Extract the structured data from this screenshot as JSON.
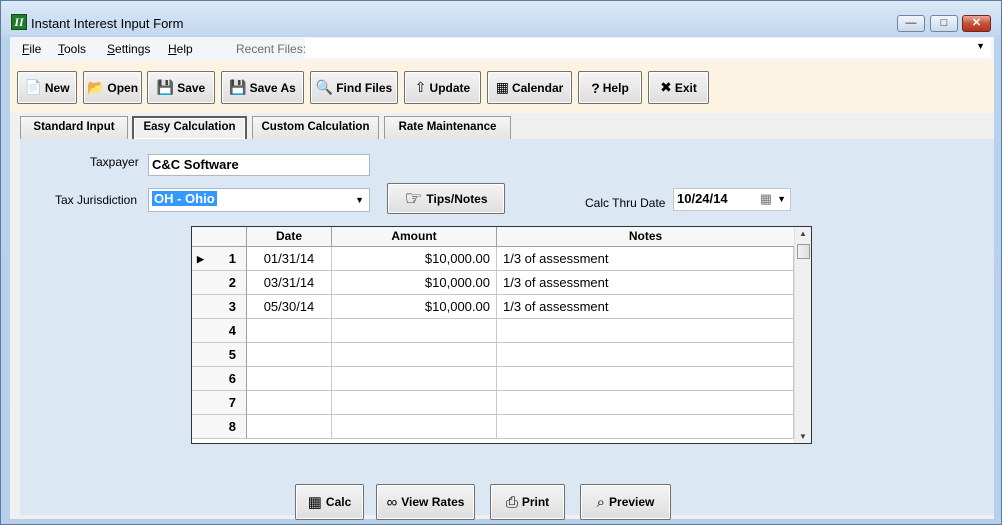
{
  "window": {
    "title": "Instant Interest Input Form",
    "app_icon_glyph": "II",
    "minimize_glyph": "—",
    "maximize_glyph": "□",
    "close_glyph": "✕"
  },
  "menu": {
    "file_key": "F",
    "file_rest": "ile",
    "tools_key": "T",
    "tools_rest": "ools",
    "settings_key": "S",
    "settings_rest": "ettings",
    "help_key": "H",
    "help_rest": "elp",
    "recent_files_label": "Recent Files:",
    "recent_files_value": "",
    "dropdown_arrow": "▼"
  },
  "toolbar": {
    "new": {
      "label": "New",
      "icon": "📄"
    },
    "open": {
      "label": "Open",
      "icon": "📂"
    },
    "save": {
      "label": "Save",
      "icon": "💾"
    },
    "save_as": {
      "label": "Save As",
      "icon": "💾"
    },
    "find_files": {
      "label": "Find Files",
      "icon": "🔍"
    },
    "update": {
      "label": "Update",
      "icon": "⇧"
    },
    "calendar": {
      "label": "Calendar",
      "icon": "▦"
    },
    "help": {
      "label": "Help",
      "icon": "?"
    },
    "exit": {
      "label": "Exit",
      "icon": "✖"
    }
  },
  "tabs": [
    {
      "label": "Standard Input",
      "active": false
    },
    {
      "label": "Easy Calculation",
      "active": true
    },
    {
      "label": "Custom Calculation",
      "active": false
    },
    {
      "label": "Rate Maintenance",
      "active": false
    }
  ],
  "form": {
    "taxpayer_label": "Taxpayer",
    "taxpayer_value": "C&C Software",
    "jurisdiction_label": "Tax Jurisdiction",
    "jurisdiction_value": "OH  - Ohio",
    "tips_label": "Tips/Notes",
    "tips_icon": "☞",
    "calc_thru_label": "Calc Thru Date",
    "calc_thru_value": "10/24/14",
    "calendar_icon": "▦",
    "dropdown_arrow": "▼"
  },
  "grid": {
    "headers": {
      "date": "Date",
      "amount": "Amount",
      "notes": "Notes"
    },
    "current_row_marker": "▶",
    "rows": [
      {
        "num": "1",
        "date": "01/31/14",
        "amount": "$10,000.00",
        "notes": "1/3 of assessment"
      },
      {
        "num": "2",
        "date": "03/31/14",
        "amount": "$10,000.00",
        "notes": "1/3 of assessment"
      },
      {
        "num": "3",
        "date": "05/30/14",
        "amount": "$10,000.00",
        "notes": "1/3 of assessment"
      },
      {
        "num": "4",
        "date": "",
        "amount": "",
        "notes": ""
      },
      {
        "num": "5",
        "date": "",
        "amount": "",
        "notes": ""
      },
      {
        "num": "6",
        "date": "",
        "amount": "",
        "notes": ""
      },
      {
        "num": "7",
        "date": "",
        "amount": "",
        "notes": ""
      },
      {
        "num": "8",
        "date": "",
        "amount": "",
        "notes": ""
      }
    ],
    "scroll_up": "▲",
    "scroll_down": "▼"
  },
  "actions": {
    "calc": {
      "label": "Calc",
      "icon": "▦"
    },
    "view_rates": {
      "label": "View Rates",
      "icon": "∞"
    },
    "print": {
      "label": "Print",
      "icon": "⎙"
    },
    "preview": {
      "label": "Preview",
      "icon": "⌕"
    }
  }
}
